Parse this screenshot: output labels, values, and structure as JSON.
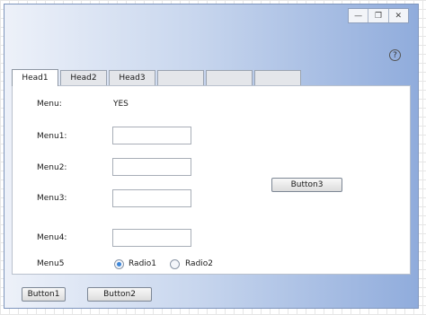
{
  "window": {
    "controls": {
      "minimize": "—",
      "restore": "❐",
      "close": "✕"
    },
    "help": "?"
  },
  "tabs": [
    {
      "label": "Head1",
      "active": true
    },
    {
      "label": "Head2",
      "active": false
    },
    {
      "label": "Head3",
      "active": false
    },
    {
      "label": "",
      "active": false
    },
    {
      "label": "",
      "active": false
    },
    {
      "label": "",
      "active": false
    }
  ],
  "form": {
    "menu_label": "Menu:",
    "menu_value": "YES",
    "menu1_label": "Menu1:",
    "menu1_value": "",
    "menu2_label": "Menu2:",
    "menu2_value": "",
    "menu3_label": "Menu3:",
    "menu3_value": "",
    "menu4_label": "Menu4:",
    "menu4_value": "",
    "menu5_label": "Menu5",
    "radio1_label": "Radio1",
    "radio1_checked": true,
    "radio2_label": "Radio2",
    "radio2_checked": false,
    "button3_label": "Button3"
  },
  "footer": {
    "button1_label": "Button1",
    "button2_label": "Button2"
  }
}
